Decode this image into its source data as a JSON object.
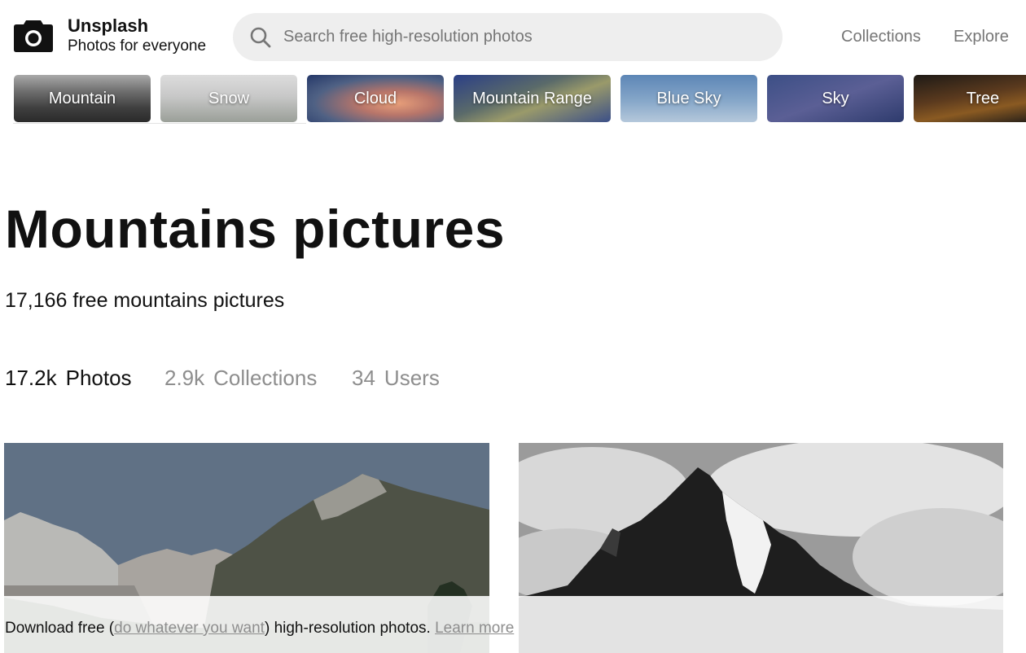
{
  "brand": {
    "name": "Unsplash",
    "tagline": "Photos for everyone",
    "logo_icon": "camera-icon"
  },
  "search": {
    "placeholder": "Search free high-resolution photos",
    "value": "",
    "icon": "search-icon"
  },
  "nav": {
    "collections": "Collections",
    "explore": "Explore"
  },
  "topics": [
    {
      "label": "Mountain"
    },
    {
      "label": "Snow"
    },
    {
      "label": "Cloud"
    },
    {
      "label": "Mountain Range"
    },
    {
      "label": "Blue Sky"
    },
    {
      "label": "Sky"
    },
    {
      "label": "Tree"
    }
  ],
  "page": {
    "title": "Mountains pictures",
    "subtitle": "17,166 free mountains pictures"
  },
  "tabs": [
    {
      "count": "17.2k",
      "label": "Photos",
      "active": true
    },
    {
      "count": "2.9k",
      "label": "Collections",
      "active": false
    },
    {
      "count": "34",
      "label": "Users",
      "active": false
    }
  ],
  "banner": {
    "prefix": "Download free (",
    "license_link": "do whatever you want",
    "middle": ") high-resolution photos. ",
    "learn_more": "Learn more"
  },
  "colors": {
    "text": "#111111",
    "muted": "#767676",
    "search_bg": "#eeeeee"
  }
}
